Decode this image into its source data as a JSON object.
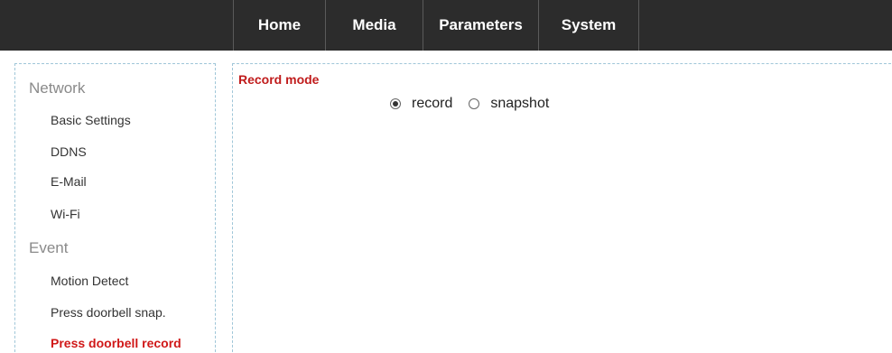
{
  "nav": {
    "items": [
      {
        "label": "Home"
      },
      {
        "label": "Media"
      },
      {
        "label": "Parameters"
      },
      {
        "label": "System"
      }
    ]
  },
  "sidebar": {
    "groups": [
      {
        "title": "Network",
        "items": [
          {
            "label": "Basic Settings"
          },
          {
            "label": "DDNS"
          },
          {
            "label": "E-Mail"
          },
          {
            "label": "Wi-Fi"
          }
        ]
      },
      {
        "title": "Event",
        "items": [
          {
            "label": "Motion Detect"
          },
          {
            "label": "Press doorbell snap."
          },
          {
            "label": "Press doorbell record",
            "active": true
          }
        ]
      }
    ]
  },
  "main": {
    "section_title": "Record mode",
    "record_mode": {
      "selected": "record",
      "options": [
        {
          "label": "record"
        },
        {
          "label": "snapshot"
        }
      ]
    }
  },
  "colors": {
    "topbar": "#2c2c2c",
    "accent_red": "#d01818",
    "group_title": "#8a8a8a",
    "frame_border": "#9fc6d8"
  }
}
